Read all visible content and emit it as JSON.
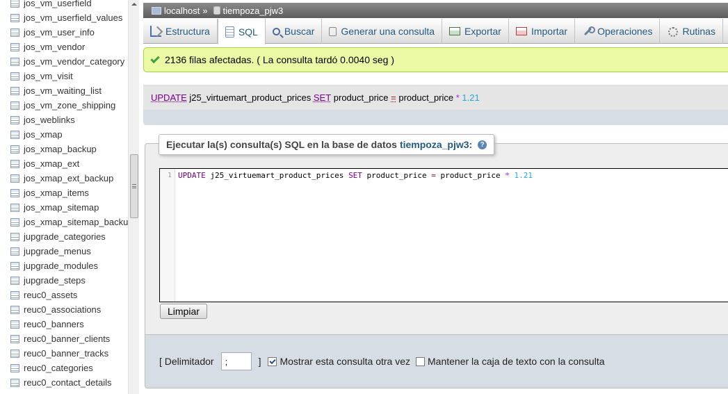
{
  "sidebar": {
    "items": [
      {
        "label": "jos_vm_userfield"
      },
      {
        "label": "jos_vm_userfield_values"
      },
      {
        "label": "jos_vm_user_info"
      },
      {
        "label": "jos_vm_vendor"
      },
      {
        "label": "jos_vm_vendor_category"
      },
      {
        "label": "jos_vm_visit"
      },
      {
        "label": "jos_vm_waiting_list"
      },
      {
        "label": "jos_vm_zone_shipping"
      },
      {
        "label": "jos_weblinks"
      },
      {
        "label": "jos_xmap"
      },
      {
        "label": "jos_xmap_backup"
      },
      {
        "label": "jos_xmap_ext"
      },
      {
        "label": "jos_xmap_ext_backup"
      },
      {
        "label": "jos_xmap_items"
      },
      {
        "label": "jos_xmap_sitemap"
      },
      {
        "label": "jos_xmap_sitemap_backup"
      },
      {
        "label": "jupgrade_categories"
      },
      {
        "label": "jupgrade_menus"
      },
      {
        "label": "jupgrade_modules"
      },
      {
        "label": "jupgrade_steps"
      },
      {
        "label": "reuc0_assets"
      },
      {
        "label": "reuc0_associations"
      },
      {
        "label": "reuc0_banners"
      },
      {
        "label": "reuc0_banner_clients"
      },
      {
        "label": "reuc0_banner_tracks"
      },
      {
        "label": "reuc0_categories"
      },
      {
        "label": "reuc0_contact_details"
      }
    ]
  },
  "breadcrumb": {
    "server": "localhost",
    "separator": "»",
    "database": "tiempoza_pjw3"
  },
  "tabs": [
    {
      "label": "Estructura",
      "icon": "structure-icon"
    },
    {
      "label": "SQL",
      "icon": "sql-icon"
    },
    {
      "label": "Buscar",
      "icon": "search-icon"
    },
    {
      "label": "Generar una consulta",
      "icon": "query-icon"
    },
    {
      "label": "Exportar",
      "icon": "export-icon"
    },
    {
      "label": "Importar",
      "icon": "import-icon"
    },
    {
      "label": "Operaciones",
      "icon": "operations-icon"
    },
    {
      "label": "Rutinas",
      "icon": "routines-icon"
    }
  ],
  "message": {
    "text": "2136 filas afectadas. ( La consulta tardó 0.0040 seg )"
  },
  "query_display": {
    "kw_update": "UPDATE",
    "table": " j25_virtuemart_product_prices ",
    "kw_set": "SET",
    "column": " product_price ",
    "op": "=",
    "expr": " product_price ",
    "star": "*",
    "num": " 1.21"
  },
  "sql_form": {
    "legend_prefix": "Ejecutar la(s) consulta(s) SQL en la base de datos",
    "legend_db": "tiempoza_pjw3:",
    "line_number": "1",
    "code": {
      "kw_update": "UPDATE",
      "table": " j25_virtuemart_product_prices ",
      "kw_set": "SET",
      "column": " product_price ",
      "op": "=",
      "expr": " product_price ",
      "star": "*",
      "num": " 1.21"
    },
    "clear_label": "Limpiar"
  },
  "options": {
    "delimiter_open": "[ Delimitador",
    "delimiter_value": ";",
    "delimiter_close": "]",
    "show_query_label": "Mostrar esta consulta otra vez",
    "show_query_checked": true,
    "keep_box_label": "Mantener la caja de texto con la consulta",
    "keep_box_checked": false
  }
}
